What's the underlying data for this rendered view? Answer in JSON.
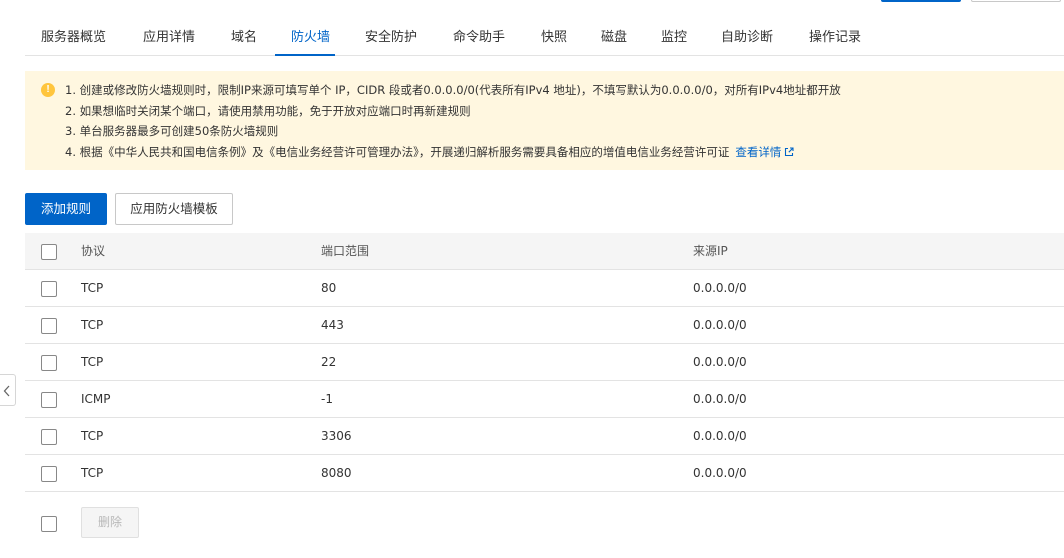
{
  "tabs": [
    {
      "label": "服务器概览"
    },
    {
      "label": "应用详情"
    },
    {
      "label": "域名"
    },
    {
      "label": "防火墙",
      "active": true
    },
    {
      "label": "安全防护"
    },
    {
      "label": "命令助手"
    },
    {
      "label": "快照"
    },
    {
      "label": "磁盘"
    },
    {
      "label": "监控"
    },
    {
      "label": "自助诊断"
    },
    {
      "label": "操作记录"
    }
  ],
  "notice": {
    "icon": "warning-circle-icon",
    "lines": [
      "1. 创建或修改防火墙规则时，限制IP来源可填写单个 IP，CIDR 段或者0.0.0.0/0(代表所有IPv4 地址)，不填写默认为0.0.0.0/0，对所有IPv4地址都开放",
      "2. 如果想临时关闭某个端口，请使用禁用功能，免于开放对应端口时再新建规则",
      "3. 单台服务器最多可创建50条防火墙规则",
      "4. 根据《中华人民共和国电信条例》及《电信业务经营许可管理办法》，开展递归解析服务需要具备相应的增值电信业务经营许可证"
    ],
    "link_label": "查看详情"
  },
  "toolbar": {
    "add_label": "添加规则",
    "template_label": "应用防火墙模板"
  },
  "table": {
    "headers": {
      "protocol": "协议",
      "port": "端口范围",
      "source": "来源IP"
    },
    "rows": [
      {
        "protocol": "TCP",
        "port": "80",
        "source": "0.0.0.0/0"
      },
      {
        "protocol": "TCP",
        "port": "443",
        "source": "0.0.0.0/0"
      },
      {
        "protocol": "TCP",
        "port": "22",
        "source": "0.0.0.0/0"
      },
      {
        "protocol": "ICMP",
        "port": "-1",
        "source": "0.0.0.0/0"
      },
      {
        "protocol": "TCP",
        "port": "3306",
        "source": "0.0.0.0/0"
      },
      {
        "protocol": "TCP",
        "port": "8080",
        "source": "0.0.0.0/0"
      }
    ]
  },
  "footer": {
    "delete_label": "删除"
  },
  "colors": {
    "accent": "#0064c8",
    "notice_bg": "#fff7e0",
    "warning": "#ffc53d"
  }
}
